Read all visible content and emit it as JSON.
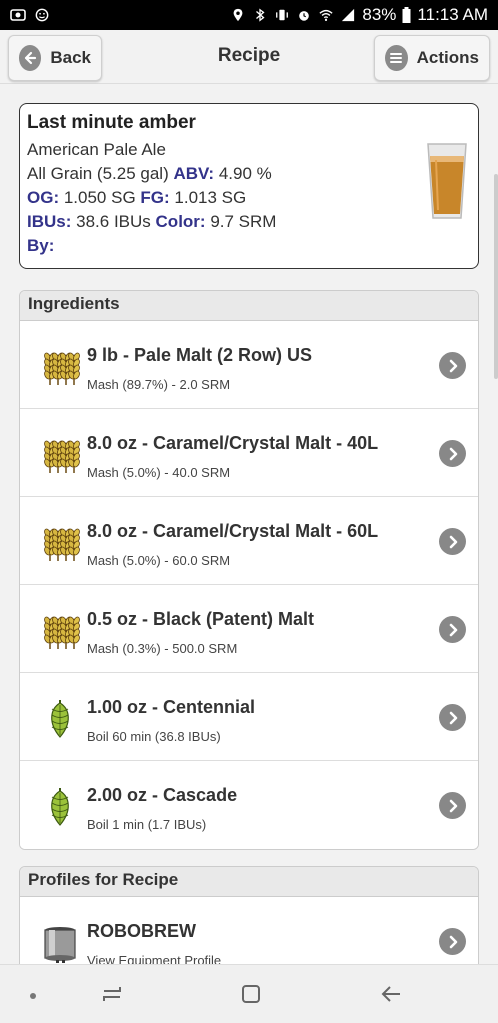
{
  "status": {
    "battery": "83%",
    "time": "11:13 AM"
  },
  "header": {
    "back_label": "Back",
    "title": "Recipe",
    "actions_label": "Actions"
  },
  "recipe": {
    "name": "Last minute amber",
    "style": "American Pale Ale",
    "method": "All Grain (5.25 gal)",
    "abv_label": "ABV:",
    "abv": "4.90 %",
    "og_label": "OG:",
    "og": "1.050 SG",
    "fg_label": "FG:",
    "fg": "1.013 SG",
    "ibu_label": "IBUs:",
    "ibu": "38.6 IBUs",
    "color_label": "Color:",
    "color": "9.7 SRM",
    "by_label": "By:"
  },
  "ingredients": {
    "heading": "Ingredients",
    "items": [
      {
        "title": "9 lb - Pale Malt (2 Row) US",
        "sub": "Mash (89.7%) - 2.0 SRM",
        "icon": "grain-icon"
      },
      {
        "title": "8.0 oz - Caramel/Crystal Malt - 40L",
        "sub": "Mash (5.0%) - 40.0 SRM",
        "icon": "grain-icon"
      },
      {
        "title": "8.0 oz - Caramel/Crystal Malt - 60L",
        "sub": "Mash (5.0%) - 60.0 SRM",
        "icon": "grain-icon"
      },
      {
        "title": "0.5 oz - Black (Patent) Malt",
        "sub": "Mash (0.3%) - 500.0 SRM",
        "icon": "grain-icon"
      },
      {
        "title": "1.00 oz - Centennial",
        "sub": "Boil 60 min (36.8 IBUs)",
        "icon": "hop-icon"
      },
      {
        "title": "2.00 oz - Cascade",
        "sub": "Boil 1 min (1.7 IBUs)",
        "icon": "hop-icon"
      }
    ]
  },
  "profiles": {
    "heading": "Profiles for Recipe",
    "items": [
      {
        "title": "ROBOBREW",
        "sub": "View Equipment Profile",
        "icon": "kettle-icon"
      }
    ]
  },
  "colors": {
    "label_blue": "#33338a",
    "beer": "#c8862a",
    "hop_green": "#9bc23a"
  }
}
